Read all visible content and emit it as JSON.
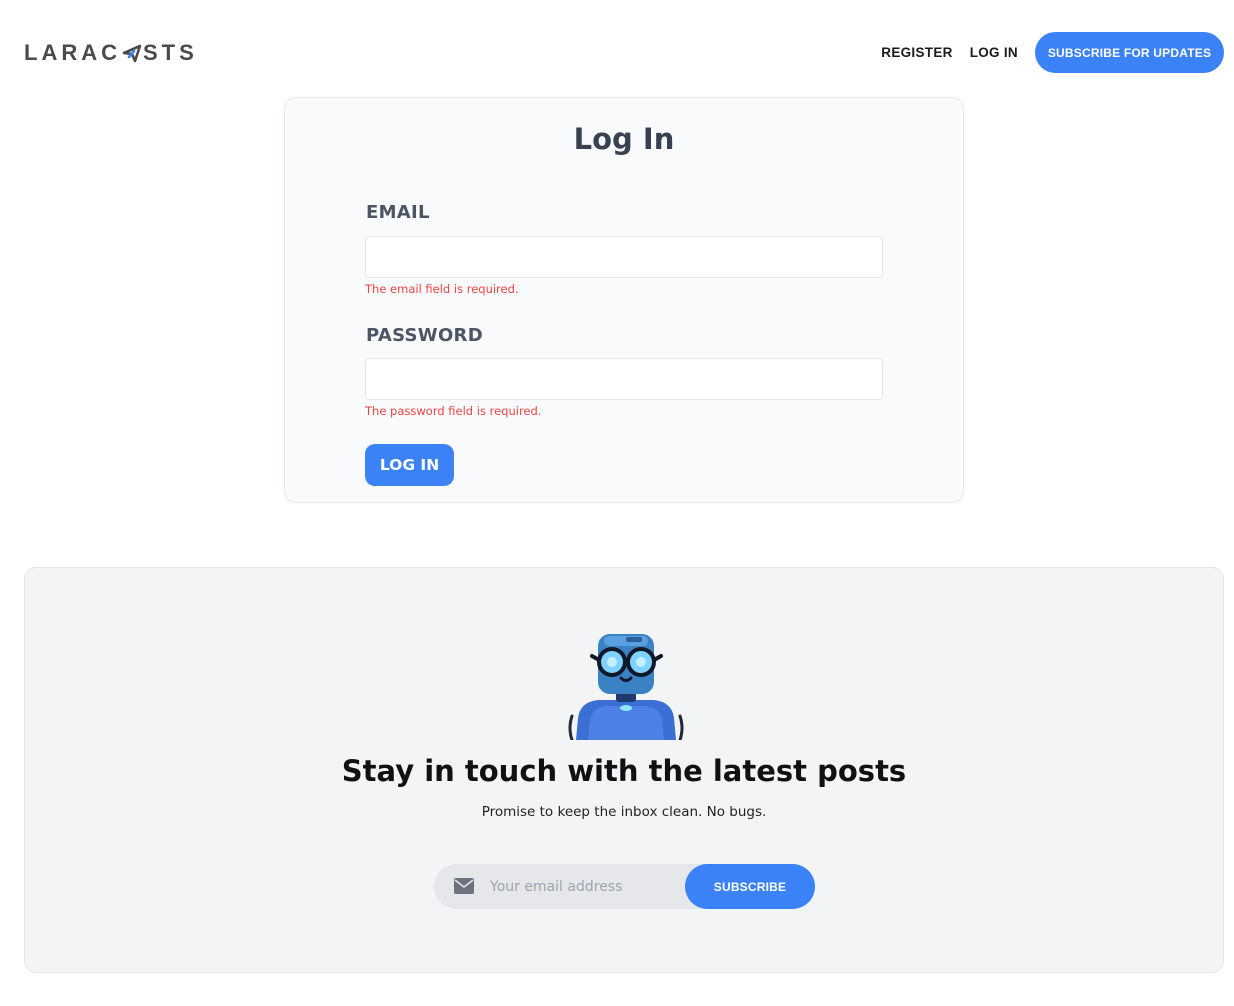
{
  "header": {
    "logo_text_left": "LARAC",
    "logo_text_right": "STS",
    "nav": {
      "register": "REGISTER",
      "login": "LOG IN",
      "subscribe": "SUBSCRIBE FOR UPDATES"
    }
  },
  "login": {
    "title": "Log In",
    "email": {
      "label": "EMAIL",
      "value": "",
      "error": "The email field is required."
    },
    "password": {
      "label": "PASSWORD",
      "value": "",
      "error": "The password field is required."
    },
    "submit_label": "LOG IN"
  },
  "newsletter": {
    "title": "Stay in touch with the latest posts",
    "subtitle": "Promise to keep the inbox clean. No bugs.",
    "input_placeholder": "Your email address",
    "submit_label": "SUBSCRIBE",
    "icons": {
      "mail": "mail-icon",
      "mascot": "robot-mascot-icon"
    }
  },
  "colors": {
    "accent": "#3b82f6",
    "error": "#ef4444",
    "card_bg": "#f9fafb",
    "newsletter_bg": "#f3f4f6"
  }
}
